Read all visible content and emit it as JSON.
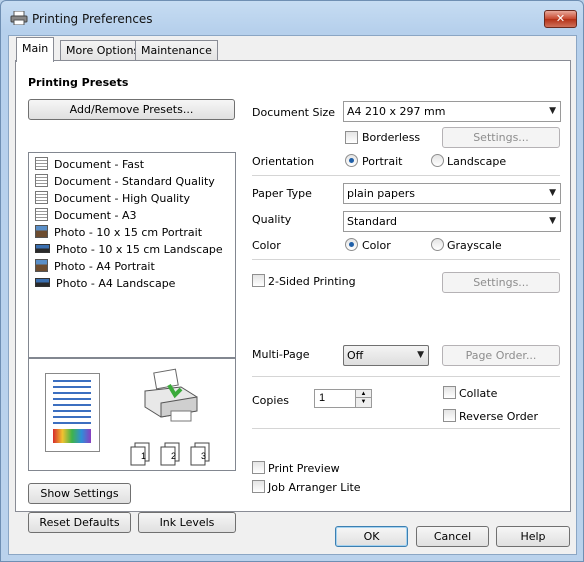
{
  "window": {
    "title": "Printing Preferences",
    "close_symbol": "✕"
  },
  "tabs": [
    {
      "label": "Main",
      "active": true
    },
    {
      "label": "More Options",
      "active": false
    },
    {
      "label": "Maintenance",
      "active": false
    }
  ],
  "presets": {
    "heading": "Printing Presets",
    "add_remove_label": "Add/Remove Presets...",
    "items": [
      {
        "label": "Document - Fast",
        "icon": "document-icon"
      },
      {
        "label": "Document - Standard Quality",
        "icon": "document-icon"
      },
      {
        "label": "Document - High Quality",
        "icon": "document-icon"
      },
      {
        "label": "Document - A3",
        "icon": "document-icon"
      },
      {
        "label": "Photo - 10 x 15 cm Portrait",
        "icon": "photo-portrait-icon"
      },
      {
        "label": "Photo - 10 x 15 cm Landscape",
        "icon": "photo-landscape-icon"
      },
      {
        "label": "Photo - A4 Portrait",
        "icon": "photo-portrait-icon"
      },
      {
        "label": "Photo - A4 Landscape",
        "icon": "photo-landscape-icon"
      }
    ]
  },
  "preview": {
    "copy_numbers": [
      "1",
      "2",
      "3"
    ]
  },
  "settings": {
    "document_size_label": "Document Size",
    "document_size_value": "A4 210 x 297 mm",
    "borderless_label": "Borderless",
    "borderless_checked": false,
    "settings_label": "Settings...",
    "orientation_label": "Orientation",
    "portrait_label": "Portrait",
    "landscape_label": "Landscape",
    "orientation_value": "Portrait",
    "paper_type_label": "Paper Type",
    "paper_type_value": "plain papers",
    "quality_label": "Quality",
    "quality_value": "Standard",
    "color_label": "Color",
    "color_option_label": "Color",
    "grayscale_label": "Grayscale",
    "color_value": "Color",
    "two_sided_label": "2-Sided Printing",
    "two_sided_settings_label": "Settings...",
    "multi_page_label": "Multi-Page",
    "multi_page_value": "Off",
    "page_order_label": "Page Order...",
    "copies_label": "Copies",
    "copies_value": "1",
    "collate_label": "Collate",
    "reverse_order_label": "Reverse Order",
    "print_preview_label": "Print Preview",
    "job_arranger_label": "Job Arranger Lite"
  },
  "bottom_left": {
    "show_settings_label": "Show Settings",
    "reset_defaults_label": "Reset Defaults",
    "ink_levels_label": "Ink Levels"
  },
  "dialog_buttons": {
    "ok": "OK",
    "cancel": "Cancel",
    "help": "Help"
  },
  "colors": {
    "title_bg": "#b9d1ea",
    "close_red": "#c7472e",
    "radio_dot": "#1f5fa8"
  }
}
